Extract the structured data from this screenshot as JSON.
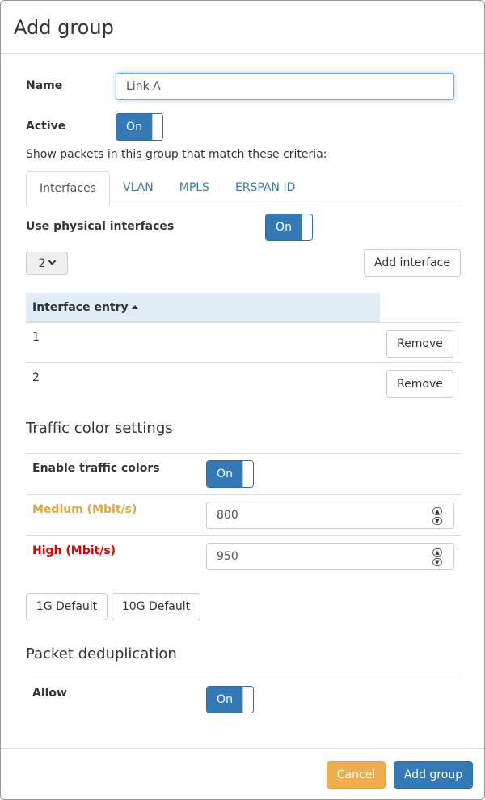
{
  "modal": {
    "title": "Add group"
  },
  "form": {
    "name_label": "Name",
    "name_value": "Link A",
    "active_label": "Active",
    "active_toggle": "On",
    "criteria_text": "Show packets in this group that match these criteria:"
  },
  "tabs": [
    {
      "label": "Interfaces",
      "active": true
    },
    {
      "label": "VLAN"
    },
    {
      "label": "MPLS"
    },
    {
      "label": "ERSPAN ID"
    }
  ],
  "interfaces": {
    "physical_label": "Use physical interfaces",
    "physical_toggle": "On",
    "select_value": "2",
    "add_button": "Add interface",
    "table_header": "Interface entry",
    "sort_icon": "sort-asc-icon",
    "rows": [
      {
        "value": "1",
        "action": "Remove"
      },
      {
        "value": "2",
        "action": "Remove"
      }
    ]
  },
  "traffic": {
    "title": "Traffic color settings",
    "enable_label": "Enable traffic colors",
    "enable_toggle": "On",
    "medium_label": "Medium (Mbit/s)",
    "medium_value": "800",
    "medium_color": "#e0a73c",
    "high_label": "High (Mbit/s)",
    "high_value": "950",
    "high_color": "#e00000",
    "default_1g": "1G Default",
    "default_10g": "10G Default"
  },
  "dedup": {
    "title": "Packet deduplication",
    "allow_label": "Allow",
    "allow_toggle": "On"
  },
  "footer": {
    "cancel": "Cancel",
    "submit": "Add group"
  }
}
